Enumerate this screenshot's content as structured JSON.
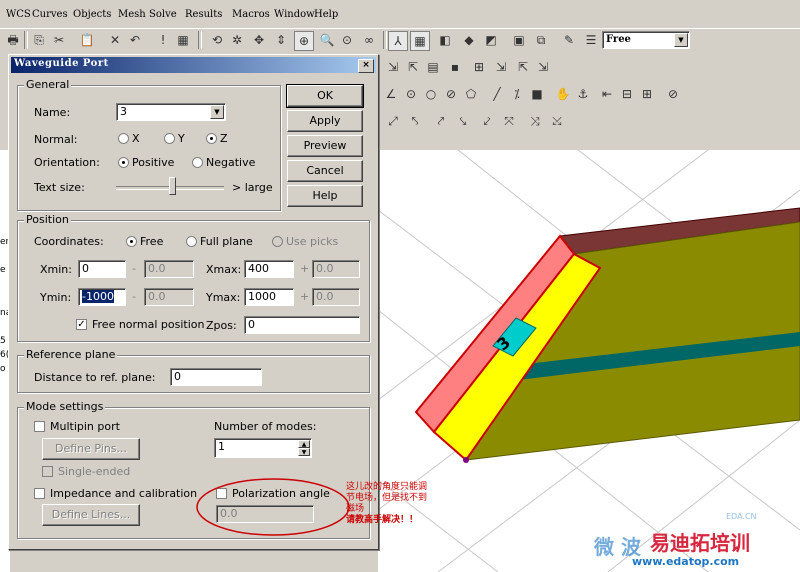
{
  "menu": [
    "WCS",
    "Curves",
    "Objects",
    "Mesh",
    "Solve",
    "Results",
    "Macros",
    "Window",
    "Help"
  ],
  "toolbar": {
    "view_mode_value": "Free"
  },
  "dialog": {
    "title": "Waveguide Port",
    "close_label": "×",
    "general": {
      "label": "General",
      "name_label": "Name:",
      "name_value": "3",
      "normal_label": "Normal:",
      "normal_options": [
        "X",
        "Y",
        "Z"
      ],
      "normal_selected": "Z",
      "orientation_label": "Orientation:",
      "orientation_options": [
        "Positive",
        "Negative"
      ],
      "orientation_selected": "Positive",
      "textsize_label": "Text size:",
      "textsize_right": "> large",
      "textsize_level": 0.52
    },
    "buttons": {
      "ok": "OK",
      "apply": "Apply",
      "preview": "Preview",
      "cancel": "Cancel",
      "help": "Help"
    },
    "position": {
      "label": "Position",
      "coordinates_label": "Coordinates:",
      "coord_options": [
        "Free",
        "Full plane",
        "Use picks"
      ],
      "coord_selected": "Free",
      "xmin_label": "Xmin:",
      "xmin_value": "0",
      "xmin_minus": "-",
      "xmin_offset": "0.0",
      "xmax_label": "Xmax:",
      "xmax_value": "400",
      "xmax_plus": "+",
      "xmax_offset": "0.0",
      "ymin_label": "Ymin:",
      "ymin_value": "-1000",
      "ymin_minus": "-",
      "ymin_offset": "0.0",
      "ymax_label": "Ymax:",
      "ymax_value": "1000",
      "ymax_plus": "+",
      "ymax_offset": "0.0",
      "free_normal_label": "Free normal position",
      "free_normal_checked": true,
      "zpos_label": "Zpos:",
      "zpos_value": "0"
    },
    "reference": {
      "label": "Reference plane",
      "distance_label": "Distance to ref. plane:",
      "distance_value": "0"
    },
    "mode": {
      "label": "Mode settings",
      "multipin_label": "Multipin port",
      "define_pins": "Define Pins...",
      "single_ended": "Single-ended",
      "num_modes_label": "Number of modes:",
      "num_modes_value": "1",
      "impedance_label": "Impedance and calibration",
      "define_lines": "Define Lines...",
      "polarization_label": "Polarization angle",
      "polarization_value": "0.0"
    }
  },
  "left_edge_text": [
    "er",
    "e",
    "na",
    "5",
    "6(",
    "o"
  ],
  "viewport": {
    "port_label": "3"
  },
  "annotation": [
    "这儿改的角度只能调",
    "节电场，但是找不到",
    "磁场",
    "请教高手解决！！"
  ],
  "watermark": {
    "cn": "易迪拓培训",
    "cn2": "微 波",
    "url": "www.edatop.com",
    "small": "EDA.CN"
  },
  "colors": {
    "title_start": "#0a246a",
    "title_end": "#a6caf0",
    "ellipse": "#cc0000",
    "yellow": "#ffff00",
    "olive": "#8b8b00"
  }
}
